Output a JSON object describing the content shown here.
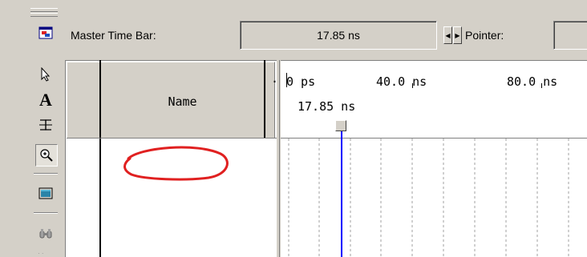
{
  "toolbar": {
    "tools": [
      {
        "icon": "waveform-editor-icon"
      },
      {
        "icon": "selection-arrow-icon"
      },
      {
        "icon": "text-tool-icon",
        "glyph": "A"
      },
      {
        "icon": "waveform-editing-tool-icon",
        "glyph": "⨳"
      },
      {
        "icon": "zoom-tool-icon",
        "glyph": "⊕"
      },
      {
        "icon": "full-screen-icon"
      },
      {
        "icon": "find-icon"
      }
    ]
  },
  "header": {
    "master_time_bar_label": "Master Time Bar:",
    "master_time_value": "17.85 ns",
    "pointer_label": "Pointer:",
    "pointer_value": ""
  },
  "grid": {
    "name_column_header": "Name",
    "time_ruler": [
      "0 ps",
      "40.0 ns",
      "80.0 ns"
    ],
    "cursor_label": "17.85 ns"
  },
  "colors": {
    "cursor": "#0000ff",
    "annotation": "#ff0000"
  }
}
